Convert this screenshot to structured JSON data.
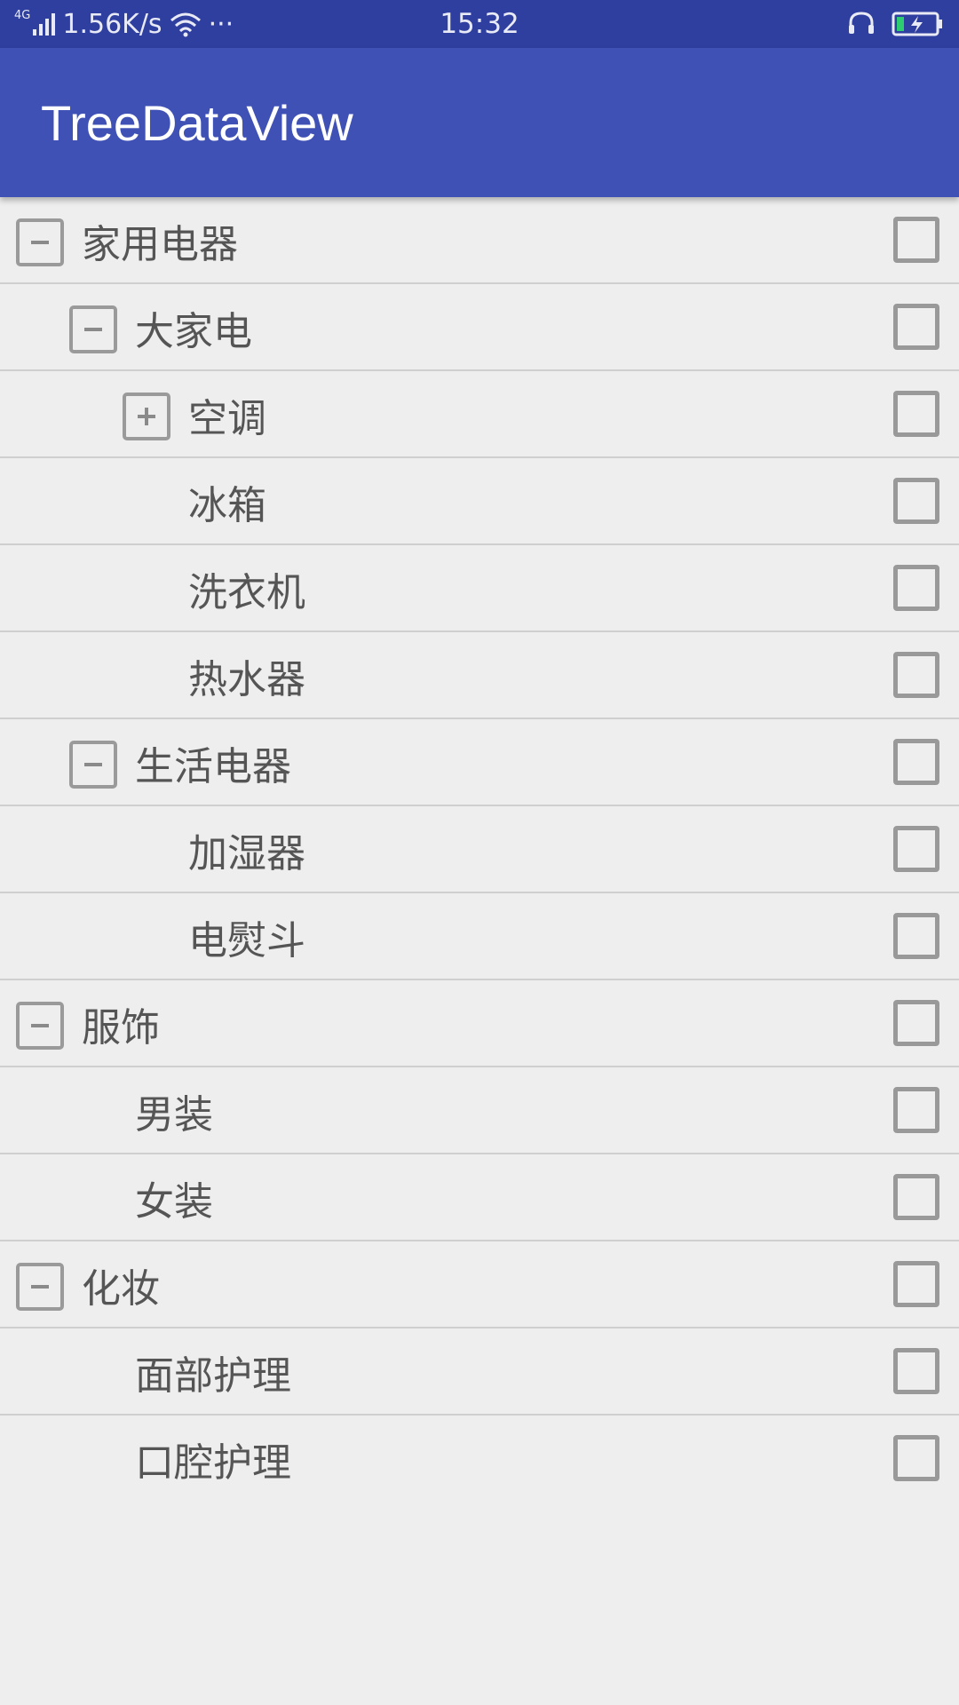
{
  "status_bar": {
    "network_type": "4G",
    "speed": "1.56K/s",
    "more": "···",
    "time": "15:32",
    "icons": [
      "signal-icon",
      "wifi-icon",
      "headset-icon",
      "battery-charging-icon"
    ]
  },
  "app_bar": {
    "title": "TreeDataView",
    "color": "#3f51b5",
    "status_color": "#2f3f9f"
  },
  "tree": {
    "rows": [
      {
        "label": "家用电器",
        "level": 0,
        "expander": "collapse",
        "checked": false
      },
      {
        "label": "大家电",
        "level": 1,
        "expander": "collapse",
        "checked": false
      },
      {
        "label": "空调",
        "level": 2,
        "expander": "expand",
        "checked": false
      },
      {
        "label": "冰箱",
        "level": 2,
        "expander": "none",
        "checked": false
      },
      {
        "label": "洗衣机",
        "level": 2,
        "expander": "none",
        "checked": false
      },
      {
        "label": "热水器",
        "level": 2,
        "expander": "none",
        "checked": false
      },
      {
        "label": "生活电器",
        "level": 1,
        "expander": "collapse",
        "checked": false
      },
      {
        "label": "加湿器",
        "level": 2,
        "expander": "none",
        "checked": false
      },
      {
        "label": "电熨斗",
        "level": 2,
        "expander": "none",
        "checked": false
      },
      {
        "label": "服饰",
        "level": 0,
        "expander": "collapse",
        "checked": false
      },
      {
        "label": "男装",
        "level": 1,
        "expander": "none",
        "checked": false
      },
      {
        "label": "女装",
        "level": 1,
        "expander": "none",
        "checked": false
      },
      {
        "label": "化妆",
        "level": 0,
        "expander": "collapse",
        "checked": false
      },
      {
        "label": "面部护理",
        "level": 1,
        "expander": "none",
        "checked": false
      },
      {
        "label": "口腔护理",
        "level": 1,
        "expander": "none",
        "checked": false
      }
    ]
  }
}
